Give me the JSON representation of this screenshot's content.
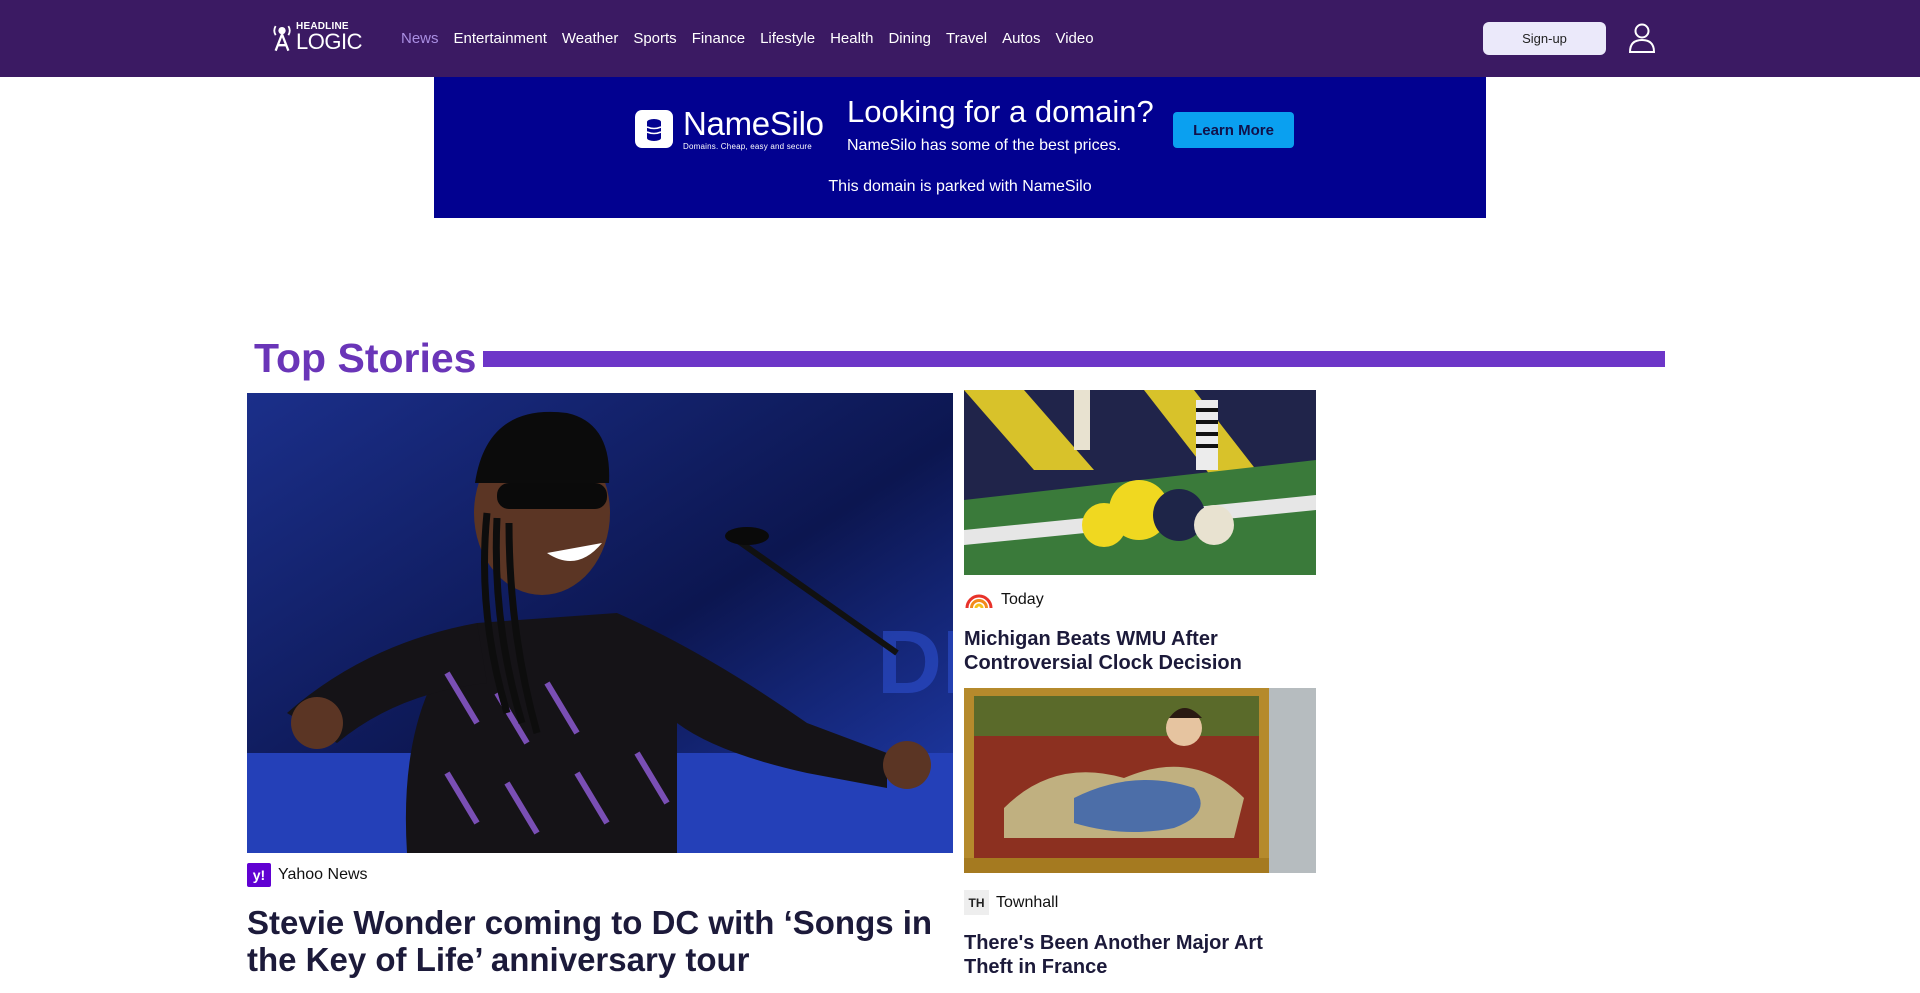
{
  "brand": {
    "line1": "HEADLINE",
    "line2": "LOGIC"
  },
  "nav": {
    "items": [
      {
        "label": "News",
        "active": true
      },
      {
        "label": "Entertainment"
      },
      {
        "label": "Weather"
      },
      {
        "label": "Sports"
      },
      {
        "label": "Finance"
      },
      {
        "label": "Lifestyle"
      },
      {
        "label": "Health"
      },
      {
        "label": "Dining"
      },
      {
        "label": "Travel"
      },
      {
        "label": "Autos"
      },
      {
        "label": "Video"
      }
    ],
    "signup_label": "Sign-up",
    "user_icon": "user-icon"
  },
  "ad": {
    "brand_name": "NameSilo",
    "brand_tagline": "Domains. Cheap, easy and secure",
    "headline": "Looking for a domain?",
    "subtext": "NameSilo has some of the best prices.",
    "cta_label": "Learn More",
    "footer": "This domain is parked with NameSilo"
  },
  "section": {
    "title": "Top Stories"
  },
  "stories": {
    "main": {
      "source": "Yahoo News",
      "source_badge": "y!",
      "title": "Stevie Wonder coming to DC with ‘Songs in the Key of Life’ anniversary tour"
    },
    "side1": {
      "source": "Today",
      "title": "Michigan Beats WMU After Controversial Clock Decision"
    },
    "side2": {
      "source": "Townhall",
      "source_badge": "TH",
      "title": "There's Been Another Major Art Theft in France"
    }
  },
  "colors": {
    "topbar": "#3b1a63",
    "nav_active": "#a98ee2",
    "ad_bg": "#020190",
    "cta_bg": "#0aa0f0",
    "section_accent": "#6d36c8",
    "yahoo_purple": "#6001d2"
  }
}
